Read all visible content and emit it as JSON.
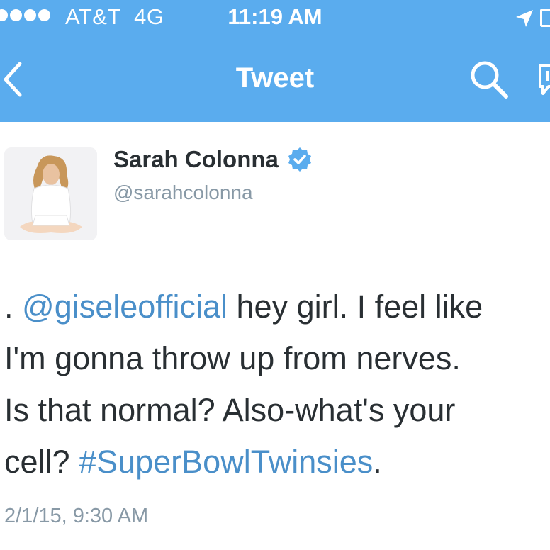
{
  "status_bar": {
    "carrier": "AT&T",
    "network": "4G",
    "time": "11:19 AM",
    "signal_icon": "signal-dots-icon",
    "location_icon": "location-arrow-icon",
    "battery_icon": "battery-icon"
  },
  "nav": {
    "title": "Tweet",
    "back_icon": "chevron-left-icon",
    "search_icon": "search-icon",
    "compose_icon": "compose-icon"
  },
  "author": {
    "name": "Sarah Colonna",
    "handle": "@sarahcolonna",
    "verified": true
  },
  "tweet": {
    "line1_prefix": ". ",
    "mention": "@giseleofficial",
    "line1_rest": " hey girl. I feel like",
    "line2": "I'm gonna throw up from nerves.",
    "line3": "Is that normal? Also-what's your",
    "line4_prefix": "cell? ",
    "hashtag": "#SuperBowlTwinsies",
    "line4_suffix": ".",
    "timestamp": "2/1/15, 9:30 AM"
  },
  "colors": {
    "nav_background": "#5aacee",
    "link": "#4a8fc9",
    "verified_badge": "#5aacee",
    "secondary_text": "#8899a6",
    "primary_text": "#292f33"
  }
}
